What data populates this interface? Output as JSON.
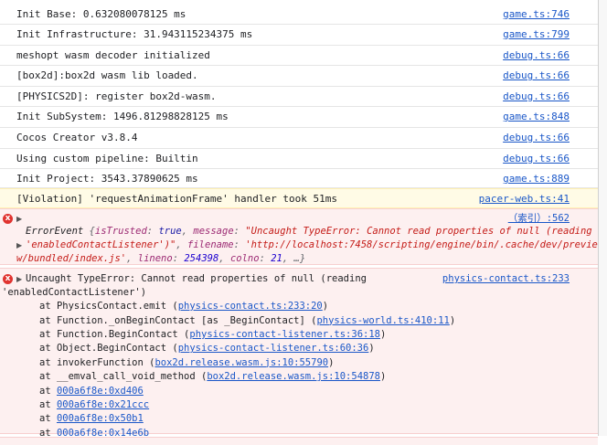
{
  "logs": [
    {
      "text": "Init Base: 0.632080078125 ms",
      "source": "game.ts:746"
    },
    {
      "text": "Init Infrastructure: 31.943115234375 ms",
      "source": "game.ts:799"
    },
    {
      "text": "meshopt wasm decoder initialized",
      "source": "debug.ts:66"
    },
    {
      "text": "[box2d]:box2d wasm lib loaded.",
      "source": "debug.ts:66"
    },
    {
      "text": "[PHYSICS2D]: register box2d-wasm.",
      "source": "debug.ts:66"
    },
    {
      "text": "Init SubSystem: 1496.81298828125 ms",
      "source": "game.ts:848"
    },
    {
      "text": "Cocos Creator v3.8.4",
      "source": "debug.ts:66"
    },
    {
      "text": "Using custom pipeline: Builtin",
      "source": "debug.ts:66"
    },
    {
      "text": "Init Project: 3543.37890625 ms",
      "source": "game.ts:889"
    }
  ],
  "warning": {
    "text": "[Violation] 'requestAnimationFrame' handler took 51ms",
    "source": "pacer-web.ts:41"
  },
  "error_event": {
    "icon": "x",
    "source": "（索引）:562",
    "name": "ErrorEvent",
    "open_brace": "{",
    "p1_key": "isTrusted",
    "p1_val": "true",
    "p2_key": "message",
    "p2_val": "\"Uncaught TypeError: Cannot read properties of null (reading",
    "p2_val_cont": "'enabledContactListener')\"",
    "p3_key": "filename",
    "p3_val": "'http://localhost:7458/scripting/engine/bin/.cache/dev/previe",
    "p3_val_cont": "w/bundled/index.js'",
    "p4_key": "lineno",
    "p4_val": "254398",
    "p5_key": "colno",
    "p5_val": "21",
    "ellipsis": "…}"
  },
  "type_error": {
    "icon": "x",
    "title": "Uncaught TypeError: Cannot read properties of null (reading",
    "title_cont": "'enabledContactListener')",
    "source": "physics-contact.ts:233",
    "stack": [
      {
        "prefix": "at PhysicsContact.emit (",
        "link": "physics-contact.ts:233:20",
        "suffix": ")"
      },
      {
        "prefix": "at Function._onBeginContact [as _BeginContact] (",
        "link": "physics-world.ts:410:11",
        "suffix": ")"
      },
      {
        "prefix": "at Function.BeginContact (",
        "link": "physics-contact-listener.ts:36:18",
        "suffix": ")"
      },
      {
        "prefix": "at Object.BeginContact (",
        "link": "physics-contact-listener.ts:60:36",
        "suffix": ")"
      },
      {
        "prefix": "at invokerFunction (",
        "link": "box2d.release.wasm.js:10:55790",
        "suffix": ")"
      },
      {
        "prefix": "at __emval_call_void_method (",
        "link": "box2d.release.wasm.js:10:54878",
        "suffix": ")"
      },
      {
        "prefix": "at ",
        "link": "000a6f8e:0xd406",
        "suffix": ""
      },
      {
        "prefix": "at ",
        "link": "000a6f8e:0x21ccc",
        "suffix": ""
      },
      {
        "prefix": "at ",
        "link": "000a6f8e:0x50b1",
        "suffix": ""
      },
      {
        "prefix": "at ",
        "link": "000a6f8e:0x14e6b",
        "suffix": ""
      }
    ]
  }
}
